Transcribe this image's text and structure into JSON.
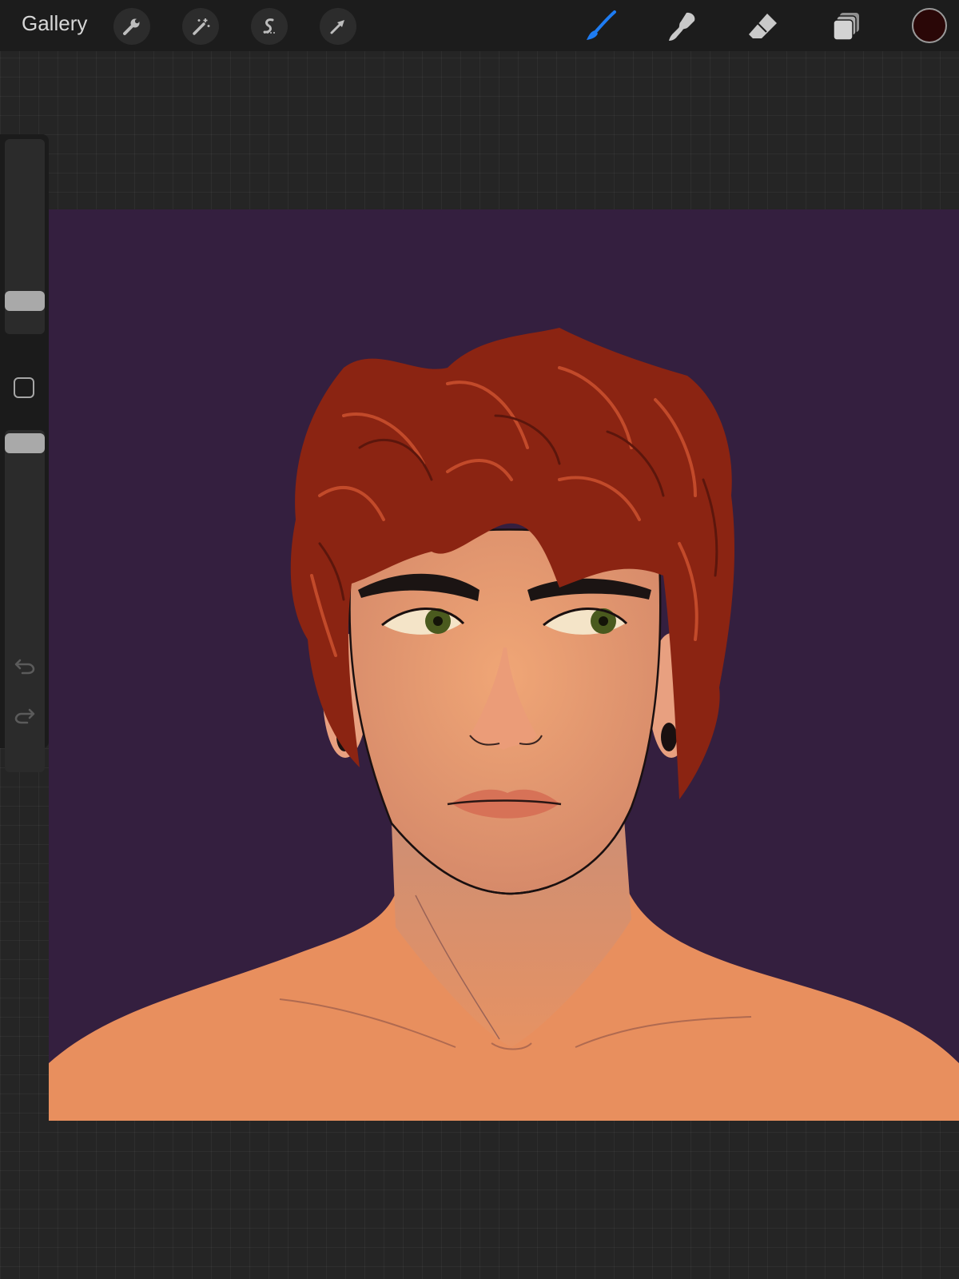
{
  "toolbar": {
    "gallery_label": "Gallery",
    "left_tools": [
      "wrench-icon",
      "magic-wand-icon",
      "selection-icon",
      "move-arrow-icon"
    ],
    "right_tools": [
      "brush-icon",
      "smudge-icon",
      "eraser-icon",
      "layers-icon"
    ],
    "active_tool": "brush",
    "active_color": "#2a0707",
    "accent_color": "#1e7cf2"
  },
  "sidebar": {
    "brush_size_level": 0.2,
    "opacity_level": 0.95,
    "controls": [
      "modify-button",
      "undo-icon",
      "redo-icon"
    ]
  },
  "canvas": {
    "background_color": "#341f3f",
    "subject": "portrait-illustration"
  }
}
